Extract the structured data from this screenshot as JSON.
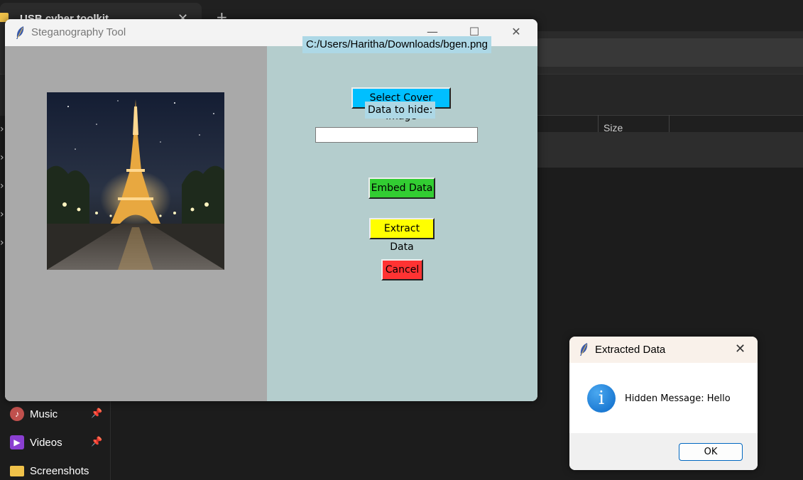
{
  "explorer": {
    "tab_title": "USB cyber toolkit",
    "tab_close": "✕",
    "new_tab": "+",
    "column_size": "Size",
    "sidebar": [
      {
        "label": "Music",
        "icon": "music-icon",
        "icon_glyph": "♪",
        "color": "#c0504d"
      },
      {
        "label": "Videos",
        "icon": "videos-icon",
        "icon_glyph": "▶",
        "color": "#8a3fd1"
      },
      {
        "label": "Screenshots",
        "icon": "folder-icon",
        "icon_glyph": "",
        "color": "#f0c24a"
      }
    ],
    "pin_glyph": "📌"
  },
  "steg": {
    "title": "Steganography Tool",
    "controls": {
      "minimize": "—",
      "maximize": "☐",
      "close": "✕"
    },
    "path": "C:/Users/Haritha/Downloads/bgen.png",
    "select_btn": "Select Cover Image",
    "data_label": "Data to hide:",
    "data_value": "",
    "embed_btn": "Embed Data",
    "extract_btn": "Extract Data",
    "cancel_btn": "Cancel",
    "colors": {
      "left_panel": "#a9a9a9",
      "right_panel": "#b4cdcd",
      "select": "#00bfff",
      "embed": "#32cd32",
      "extract": "#ffff00",
      "cancel": "#ff3333",
      "label_bg": "#add8e6"
    }
  },
  "dialog": {
    "title": "Extracted Data",
    "close": "✕",
    "icon_glyph": "i",
    "message": "Hidden Message: Hello",
    "ok": "OK"
  }
}
